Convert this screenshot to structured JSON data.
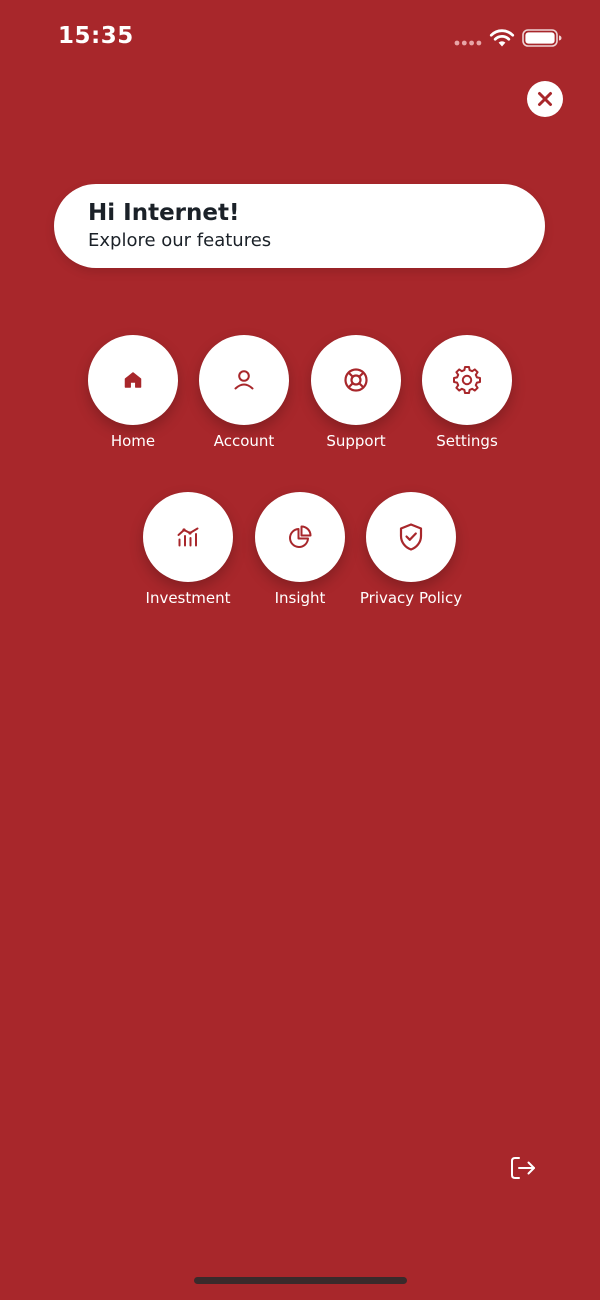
{
  "status_bar": {
    "time": "15:35"
  },
  "greeting": {
    "title": "Hi Internet!",
    "subtitle": "Explore our features"
  },
  "features": [
    {
      "label": "Home",
      "icon": "home-icon"
    },
    {
      "label": "Account",
      "icon": "user-icon"
    },
    {
      "label": "Support",
      "icon": "lifebuoy-icon"
    },
    {
      "label": "Settings",
      "icon": "gear-icon"
    },
    {
      "label": "Investment",
      "icon": "investment-chart-icon"
    },
    {
      "label": "Insight",
      "icon": "pie-chart-icon"
    },
    {
      "label": "Privacy Policy",
      "icon": "shield-check-icon"
    }
  ],
  "colors": {
    "background": "#a8272b",
    "accent": "#a8272b",
    "card": "#ffffff",
    "text_dark": "#1b2128"
  }
}
